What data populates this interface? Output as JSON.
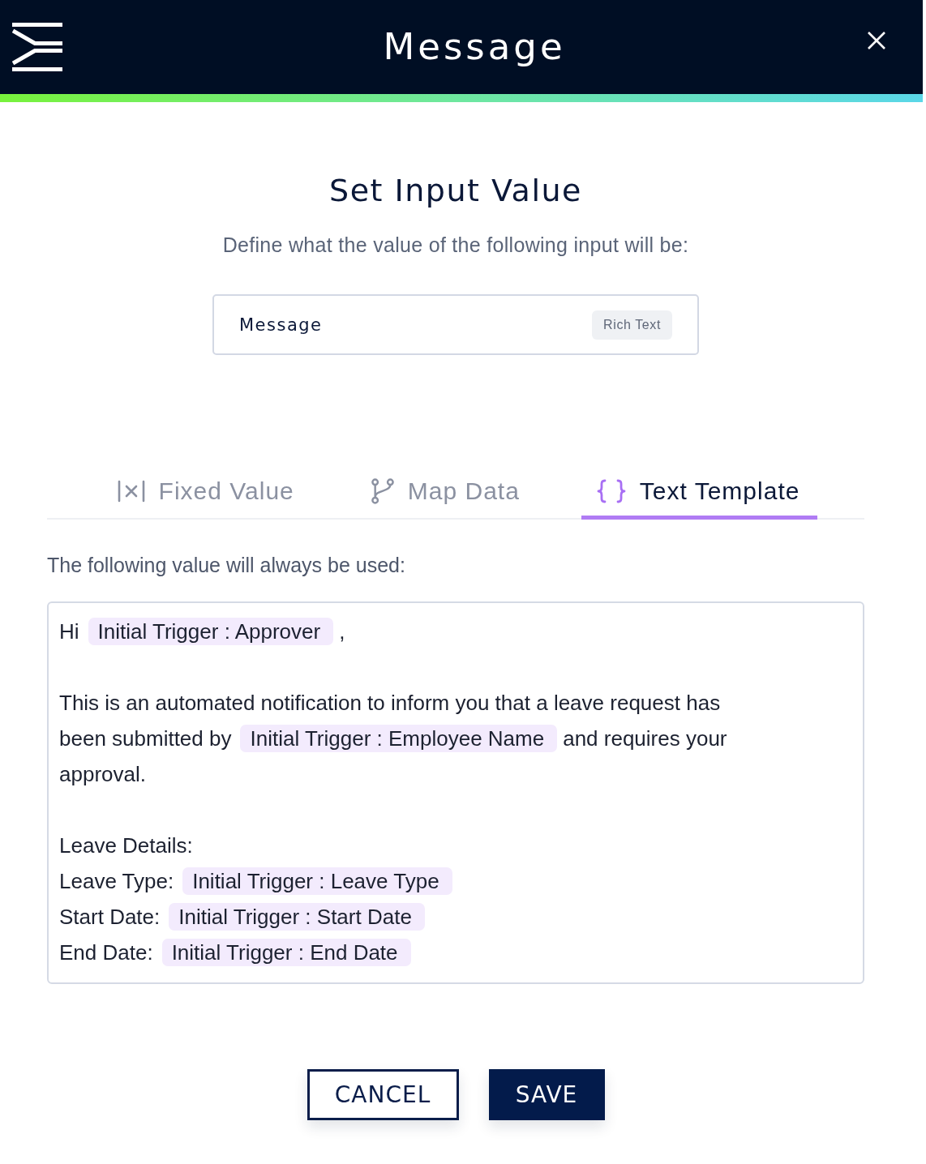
{
  "header": {
    "title": "Message"
  },
  "heading": "Set Input Value",
  "subtitle": "Define what the value of the following input will be:",
  "input_card": {
    "name": "Message",
    "type_badge": "Rich Text"
  },
  "tabs": [
    {
      "label": "Fixed Value",
      "selected": false
    },
    {
      "label": "Map Data",
      "selected": false
    },
    {
      "label": "Text Template",
      "selected": true
    }
  ],
  "value_label": "The following value will always be used:",
  "template_editor": {
    "paragraphs": [
      {
        "lines": [
          {
            "segments": [
              {
                "kind": "text",
                "text": "Hi"
              },
              {
                "kind": "variable",
                "text": "Initial Trigger : Approver"
              },
              {
                "kind": "text",
                "text": ","
              }
            ]
          }
        ]
      },
      {
        "lines": [
          {
            "segments": [
              {
                "kind": "text",
                "text": "This is an automated notification to inform you that a leave request has"
              }
            ]
          },
          {
            "segments": [
              {
                "kind": "text",
                "text": "been submitted by"
              },
              {
                "kind": "variable",
                "text": "Initial Trigger : Employee Name"
              },
              {
                "kind": "text",
                "text": "and requires your"
              }
            ]
          },
          {
            "segments": [
              {
                "kind": "text",
                "text": "approval."
              }
            ]
          }
        ]
      },
      {
        "lines": [
          {
            "segments": [
              {
                "kind": "text",
                "text": "Leave Details:"
              }
            ]
          },
          {
            "segments": [
              {
                "kind": "text",
                "text": "Leave Type:"
              },
              {
                "kind": "variable",
                "text": "Initial Trigger : Leave Type"
              }
            ]
          },
          {
            "segments": [
              {
                "kind": "text",
                "text": "Start Date:"
              },
              {
                "kind": "variable",
                "text": "Initial Trigger : Start Date"
              }
            ]
          },
          {
            "segments": [
              {
                "kind": "text",
                "text": "End Date:"
              },
              {
                "kind": "variable",
                "text": "Initial Trigger : End Date"
              }
            ]
          }
        ]
      }
    ]
  },
  "buttons": [
    {
      "label": "CANCEL",
      "kind": "secondary"
    },
    {
      "label": "SAVE",
      "kind": "primary"
    }
  ]
}
